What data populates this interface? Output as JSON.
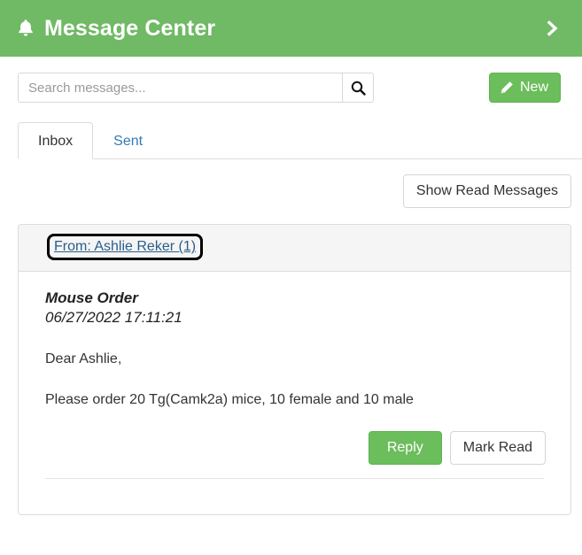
{
  "header": {
    "title": "Message Center",
    "bell_icon": "bell-icon",
    "expand_icon": "chevron-right-icon",
    "background_color": "#70b965",
    "text_color": "#ffffff"
  },
  "toolbar": {
    "search": {
      "placeholder": "Search messages...",
      "value": "",
      "button_icon": "search-icon"
    },
    "new_button": {
      "label": "New",
      "icon": "pencil-icon",
      "color": "#6cbd5c"
    }
  },
  "tabs": [
    {
      "label": "Inbox",
      "active": true
    },
    {
      "label": "Sent",
      "active": false
    }
  ],
  "actions": {
    "show_read_label": "Show Read Messages"
  },
  "message_thread": {
    "sender_label": "From: Ashlie Reker (1)",
    "message": {
      "subject": "Mouse Order",
      "timestamp": "06/27/2022 17:11:21",
      "greeting": "Dear Ashlie,",
      "body": "Please order 20 Tg(Camk2a) mice, 10 female and 10 male",
      "reply_label": "Reply",
      "mark_read_label": "Mark Read"
    }
  }
}
